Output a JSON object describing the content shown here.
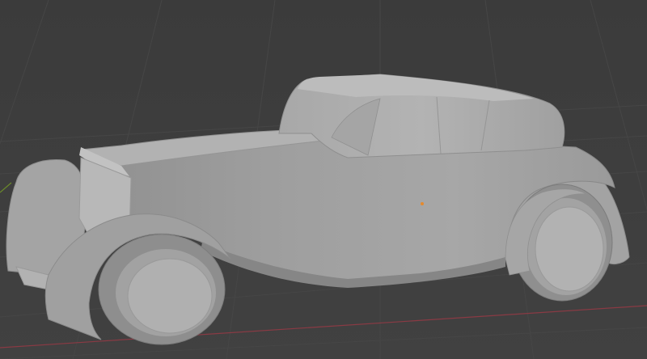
{
  "viewport": {
    "background_color": "#3c3c3c",
    "grid_color": "#474747",
    "x_axis_color": "#8a3a44",
    "y_axis_color": "#6b8a2a",
    "origin_color": "#e58a2e"
  },
  "model": {
    "base_color": "#9c9c9c",
    "light_color": "#b4b4b4",
    "shadow_color": "#7e7e7e",
    "tire_color": "#8e8e8e"
  }
}
